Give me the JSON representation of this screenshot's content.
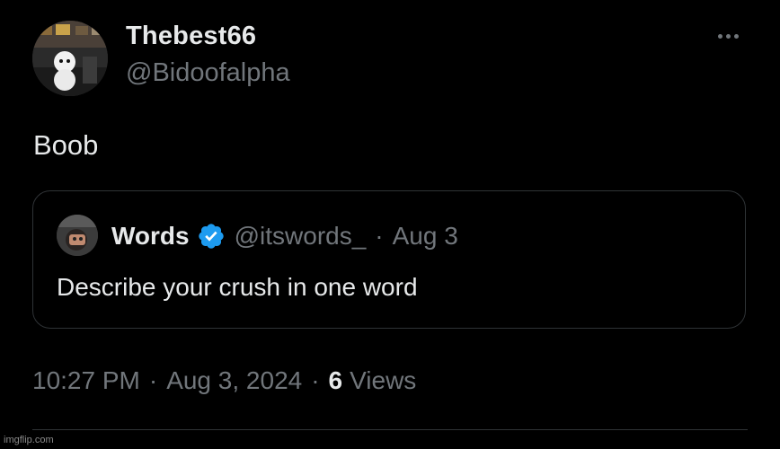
{
  "post": {
    "author": {
      "display_name": "Thebest66",
      "handle": "@Bidoofalpha",
      "avatar_icon": "profile-photo"
    },
    "more_icon": "more-horizontal-icon",
    "text": "Boob",
    "quote": {
      "author_name": "Words",
      "verified": true,
      "verified_color": "#1d9bf0",
      "handle": "@itswords_",
      "separator": "·",
      "date": "Aug 3",
      "text": "Describe your crush in one word"
    },
    "meta": {
      "time": "10:27 PM",
      "separator": "·",
      "date": "Aug 3, 2024",
      "views_count": "6",
      "views_label": "Views"
    }
  },
  "watermark": "imgflip.com",
  "colors": {
    "background": "#000000",
    "primary_text": "#e7e9ea",
    "secondary_text": "#71767b",
    "border": "#2f3336"
  }
}
